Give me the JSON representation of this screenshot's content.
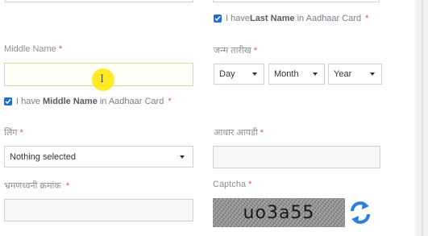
{
  "last_name_checkbox": {
    "prefix": "I have",
    "bold": "Last Name",
    "suffix": "in Aadhaar Card",
    "required": "*"
  },
  "middle_name": {
    "label": "Middle Name",
    "required": "*",
    "value": ""
  },
  "middle_name_checkbox": {
    "prefix": "I have",
    "bold": "Middle Name",
    "suffix": "in Aadhaar Card",
    "required": "*"
  },
  "dob": {
    "label": "जन्म तारीख",
    "required": "*",
    "day": "Day",
    "month": "Month",
    "year": "Year"
  },
  "gender": {
    "label": "लिंग",
    "required": "*",
    "selected": "Nothing selected"
  },
  "aadhaar": {
    "label": "आधार आयडी",
    "required": "*"
  },
  "mobile": {
    "label": "भ्रमणध्वनी क्रमांक",
    "required": "*"
  },
  "captcha": {
    "label": "Captcha",
    "required": "*",
    "text": "uo3a55"
  },
  "colors": {
    "accent": "#1f6fd1",
    "required": "#d9534f",
    "refresh": "#2a7de1"
  },
  "icons": {
    "checkbox": "check-icon",
    "dropdown": "caret-down-icon",
    "refresh": "refresh-icon",
    "cursor": "text-cursor-icon"
  }
}
